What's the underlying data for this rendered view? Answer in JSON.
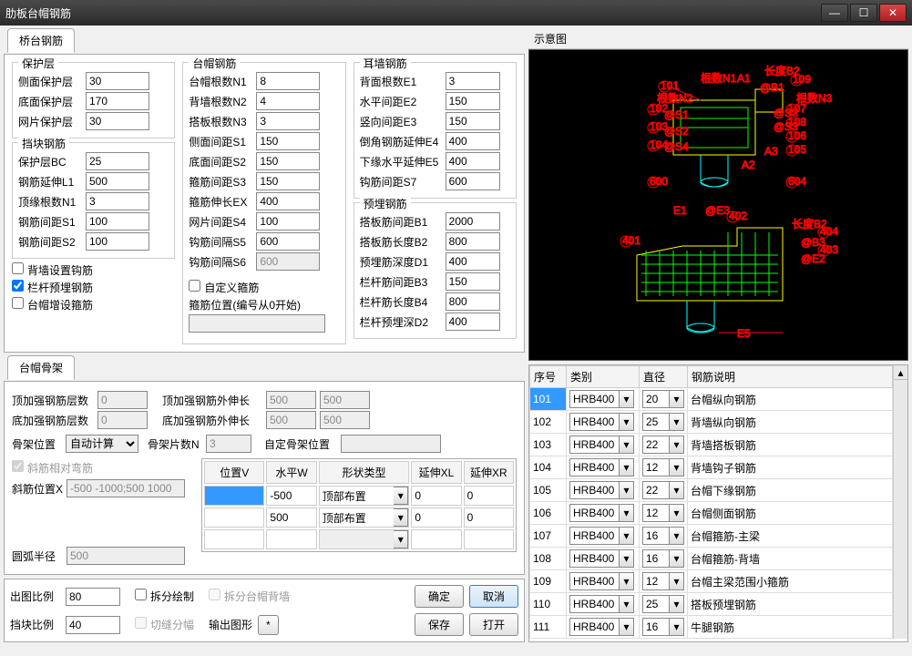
{
  "window": {
    "title": "肋板台帽钢筋"
  },
  "tab_qiaotai": "桥台钢筋",
  "grp_baohu": {
    "legend": "保护层",
    "f1": {
      "label": "侧面保护层",
      "value": "30"
    },
    "f2": {
      "label": "底面保护层",
      "value": "170"
    },
    "f3": {
      "label": "网片保护层",
      "value": "30"
    }
  },
  "grp_dangkuai": {
    "legend": "挡块钢筋",
    "f1": {
      "label": "保护层BC",
      "value": "25"
    },
    "f2": {
      "label": "钢筋延伸L1",
      "value": "500"
    },
    "f3": {
      "label": "顶缘根数N1",
      "value": "3"
    },
    "f4": {
      "label": "钢筋间距S1",
      "value": "100"
    },
    "f5": {
      "label": "钢筋间距S2",
      "value": "100"
    }
  },
  "grp_taimao": {
    "legend": "台帽钢筋",
    "f1": {
      "label": "台帽根数N1",
      "value": "8"
    },
    "f2": {
      "label": "背墙根数N2",
      "value": "4"
    },
    "f3": {
      "label": "搭板根数N3",
      "value": "3"
    },
    "f4": {
      "label": "侧面间距S1",
      "value": "150"
    },
    "f5": {
      "label": "底面间距S2",
      "value": "150"
    },
    "f6": {
      "label": "箍筋间距S3",
      "value": "150"
    },
    "f7": {
      "label": "箍筋伸长EX",
      "value": "400"
    },
    "f8": {
      "label": "网片间距S4",
      "value": "100"
    },
    "f9": {
      "label": "钩筋间隔S5",
      "value": "600"
    },
    "f10": {
      "label": "钩筋间隔S6",
      "value": "600"
    }
  },
  "grp_erqiang": {
    "legend": "耳墙钢筋",
    "f1": {
      "label": "背面根数E1",
      "value": "3"
    },
    "f2": {
      "label": "水平间距E2",
      "value": "150"
    },
    "f3": {
      "label": "竖向间距E3",
      "value": "150"
    },
    "f4": {
      "label": "倒角钢筋延伸E4",
      "value": "400"
    },
    "f5": {
      "label": "下缘水平延伸E5",
      "value": "400"
    },
    "f6": {
      "label": "钩筋间距S7",
      "value": "600"
    }
  },
  "grp_yumai": {
    "legend": "预埋钢筋",
    "f1": {
      "label": "搭板筋间距B1",
      "value": "2000"
    },
    "f2": {
      "label": "搭板筋长度B2",
      "value": "800"
    },
    "f3": {
      "label": "预埋筋深度D1",
      "value": "400"
    },
    "f4": {
      "label": "栏杆筋间距B3",
      "value": "150"
    },
    "f5": {
      "label": "栏杆筋长度B4",
      "value": "800"
    },
    "f6": {
      "label": "栏杆预埋深D2",
      "value": "400"
    }
  },
  "chk1": "背墙设置钩筋",
  "chk2": "栏杆预埋钢筋",
  "chk3": "台帽增设箍筋",
  "chk4": "自定义箍筋",
  "lbl_gj_pos": "箍筋位置(编号从0开始)",
  "tab_gujia": "台帽骨架",
  "gujia": {
    "f1": {
      "label": "顶加强钢筋层数",
      "value": "0"
    },
    "f2": {
      "label": "底加强钢筋层数",
      "value": "0"
    },
    "f3": {
      "label": "顶加强钢筋外伸长",
      "v1": "500",
      "v2": "500"
    },
    "f4": {
      "label": "底加强钢筋外伸长",
      "v1": "500",
      "v2": "500"
    },
    "f5": {
      "label": "骨架位置",
      "value": "自动计算"
    },
    "f6": {
      "label": "骨架片数N",
      "value": "3"
    },
    "f7": {
      "label": "自定骨架位置"
    },
    "chk_xj": "斜筋相对弯筋",
    "xjpos": {
      "label": "斜筋位置X",
      "value": "-500 -1000;500 1000"
    },
    "arc": {
      "label": "圆弧半径",
      "value": "500"
    }
  },
  "inner_hdr": {
    "c1": "位置V",
    "c2": "水平W",
    "c3": "形状类型",
    "c4": "延伸XL",
    "c5": "延伸XR"
  },
  "inner_rows": [
    {
      "v": "",
      "w": "-500",
      "t": "顶部布置",
      "xl": "0",
      "xr": "0",
      "sel": true
    },
    {
      "v": "",
      "w": "500",
      "t": "顶部布置",
      "xl": "0",
      "xr": "0"
    },
    {
      "v": "",
      "w": "",
      "t": "",
      "xl": "",
      "xr": ""
    }
  ],
  "bottom": {
    "f1": {
      "label": "出图比例",
      "value": "80"
    },
    "f2": {
      "label": "挡块比例",
      "value": "40"
    },
    "chk1": "拆分绘制",
    "chk2": "切缝分幅",
    "chk3": "拆分台帽背墙",
    "lbl_out": "输出图形",
    "star": "*",
    "ok": "确定",
    "cancel": "取消",
    "save": "保存",
    "open": "打开"
  },
  "diagram_title": "示意图",
  "rebar_hdr": {
    "c1": "序号",
    "c2": "类别",
    "c3": "直径",
    "c4": "钢筋说明"
  },
  "rebar_rows": [
    {
      "no": "101",
      "type": "HRB400",
      "dia": "20",
      "desc": "台帽纵向钢筋",
      "sel": true
    },
    {
      "no": "102",
      "type": "HRB400",
      "dia": "25",
      "desc": "背墙纵向钢筋"
    },
    {
      "no": "103",
      "type": "HRB400",
      "dia": "22",
      "desc": "背墙搭板钢筋"
    },
    {
      "no": "104",
      "type": "HRB400",
      "dia": "12",
      "desc": "背墙钩子钢筋"
    },
    {
      "no": "105",
      "type": "HRB400",
      "dia": "22",
      "desc": "台帽下缘钢筋"
    },
    {
      "no": "106",
      "type": "HRB400",
      "dia": "12",
      "desc": "台帽侧面钢筋"
    },
    {
      "no": "107",
      "type": "HRB400",
      "dia": "16",
      "desc": "台帽箍筋-主梁"
    },
    {
      "no": "108",
      "type": "HRB400",
      "dia": "16",
      "desc": "台帽箍筋-背墙"
    },
    {
      "no": "109",
      "type": "HRB400",
      "dia": "12",
      "desc": "台帽主梁范围小箍筋"
    },
    {
      "no": "110",
      "type": "HRB400",
      "dia": "25",
      "desc": "搭板预埋钢筋"
    },
    {
      "no": "111",
      "type": "HRB400",
      "dia": "16",
      "desc": "牛腿钢筋"
    }
  ]
}
